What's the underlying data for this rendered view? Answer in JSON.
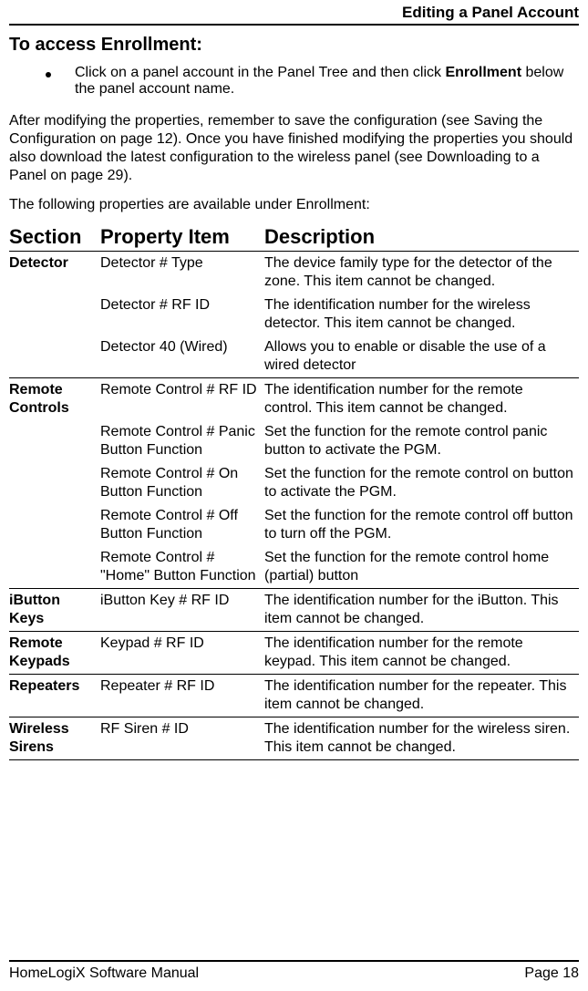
{
  "header": {
    "title": "Editing a Panel Account"
  },
  "section_heading": "To access Enrollment:",
  "bullet": {
    "pre": "Click on a panel account in the Panel Tree and then click ",
    "bold": "Enrollment",
    "post": " below the panel account name."
  },
  "para1": "After modifying the properties, remember to save the configuration (see Saving the Configuration  on page 12). Once you have finished modifying the properties you should also download the latest configuration to the wireless panel (see Downloading to a Panel  on page 29).",
  "para2": "The following properties are available under Enrollment:",
  "table": {
    "headers": {
      "section": "Section",
      "property": "Property Item",
      "description": "Description"
    },
    "rows": {
      "r1": {
        "section": "Detector",
        "property": "Detector # Type",
        "desc": "The device family type for the detector of the zone. This item cannot be changed."
      },
      "r2": {
        "section": "",
        "property": "Detector # RF ID",
        "desc": "The identification number for the wireless detector. This item cannot be changed."
      },
      "r3": {
        "section": "",
        "property": "Detector 40 (Wired)",
        "desc": "Allows you to enable or disable the use of a wired detector"
      },
      "r4": {
        "section": "Remote Controls",
        "property": "Remote Control # RF ID",
        "desc": "The identification number for the remote control. This item cannot be changed."
      },
      "r5": {
        "section": "",
        "property": "Remote Control # Panic Button Function",
        "desc": "Set the function for the remote control panic button to activate the PGM."
      },
      "r6": {
        "section": "",
        "property": "Remote Control # On Button Function",
        "desc": "Set the function for the remote control on button to activate the PGM."
      },
      "r7": {
        "section": "",
        "property": "Remote Control # Off Button Function",
        "desc": "Set the function for the remote control off button to turn off the PGM."
      },
      "r8": {
        "section": "",
        "property": "Remote Control # \"Home\" Button Function",
        "desc": "Set the function for the remote control home (partial) button"
      },
      "r9": {
        "section": "iButton Keys",
        "property": "iButton Key # RF ID",
        "desc": "The identification number for the iButton. This item cannot be changed."
      },
      "r10": {
        "section": "Remote Keypads",
        "property": "Keypad # RF ID",
        "desc": "The identification number for the remote keypad. This item cannot be changed."
      },
      "r11": {
        "section": "Repeaters",
        "property": "Repeater # RF ID",
        "desc": "The identification number for the repeater. This item cannot be changed."
      },
      "r12": {
        "section": "Wireless Sirens",
        "property": "RF Siren # ID",
        "desc": "The identification number for the wireless siren. This item cannot be changed."
      }
    }
  },
  "footer": {
    "left": "HomeLogiX Software Manual",
    "right": "Page 18"
  }
}
